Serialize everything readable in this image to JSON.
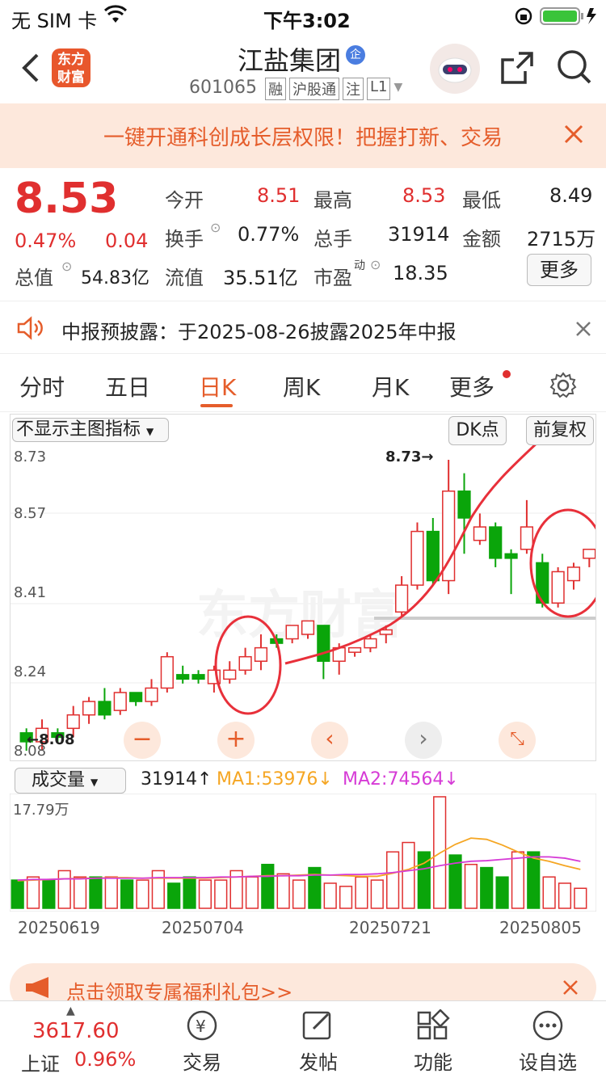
{
  "status": {
    "carrier": "无 SIM 卡",
    "time": "下午3:02"
  },
  "nav": {
    "title": "江盐集团",
    "code": "601065",
    "tags": [
      "融",
      "沪股通",
      "注",
      "L1"
    ]
  },
  "banner": {
    "text": "一键开通科创成长层权限！把握打新、交易"
  },
  "quote": {
    "price": "8.53",
    "pct": "0.47%",
    "change": "0.04",
    "open_label": "今开",
    "open": "8.51",
    "high_label": "最高",
    "high": "8.53",
    "low_label": "最低",
    "low": "8.49",
    "turnover_label": "换手",
    "turnover": "0.77%",
    "vol_label": "总手",
    "vol": "31914",
    "amount_label": "金额",
    "amount": "2715万",
    "mcap_label": "总值",
    "mcap": "54.83亿",
    "float_label": "流值",
    "float": "35.51亿",
    "pe_label": "市盈",
    "pe_sup": "动",
    "pe": "18.35",
    "more": "更多"
  },
  "notice": {
    "text": "中报预披露：于2025-08-26披露2025年中报"
  },
  "tabs": [
    "分时",
    "五日",
    "日K",
    "周K",
    "月K",
    "更多"
  ],
  "chart": {
    "indicator": "不显示主图指标",
    "dk": "DK点",
    "adjust": "前复权",
    "y_labels": [
      "8.73",
      "8.57",
      "8.41",
      "8.24",
      "8.08"
    ],
    "high_mark": "8.73→",
    "low_mark": "←8.08",
    "vol_label": "成交量",
    "vol_value": "31914↑",
    "ma1": "MA1:53976↓",
    "ma2": "MA2:74564↓",
    "vol_max": "17.79万",
    "dates": [
      "20250619",
      "20250704",
      "20250721",
      "20250805"
    ],
    "colors": {
      "up": "#e02f2f",
      "down": "#0aa50a",
      "ma1": "#f5a623",
      "ma2": "#d63bd6"
    }
  },
  "chart_data": {
    "type": "candlestick",
    "ylim": [
      8.08,
      8.73
    ],
    "candles": [
      {
        "o": 8.12,
        "c": 8.1,
        "h": 8.13,
        "l": 8.08
      },
      {
        "o": 8.1,
        "c": 8.13,
        "h": 8.15,
        "l": 8.08
      },
      {
        "o": 8.12,
        "c": 8.11,
        "h": 8.13,
        "l": 8.1
      },
      {
        "o": 8.13,
        "c": 8.16,
        "h": 8.18,
        "l": 8.11
      },
      {
        "o": 8.16,
        "c": 8.19,
        "h": 8.2,
        "l": 8.14
      },
      {
        "o": 8.19,
        "c": 8.16,
        "h": 8.22,
        "l": 8.15
      },
      {
        "o": 8.17,
        "c": 8.21,
        "h": 8.22,
        "l": 8.16
      },
      {
        "o": 8.21,
        "c": 8.19,
        "h": 8.21,
        "l": 8.18
      },
      {
        "o": 8.19,
        "c": 8.22,
        "h": 8.24,
        "l": 8.18
      },
      {
        "o": 8.22,
        "c": 8.29,
        "h": 8.3,
        "l": 8.21
      },
      {
        "o": 8.25,
        "c": 8.24,
        "h": 8.27,
        "l": 8.23
      },
      {
        "o": 8.25,
        "c": 8.24,
        "h": 8.26,
        "l": 8.23
      },
      {
        "o": 8.23,
        "c": 8.26,
        "h": 8.27,
        "l": 8.21
      },
      {
        "o": 8.24,
        "c": 8.26,
        "h": 8.28,
        "l": 8.23
      },
      {
        "o": 8.26,
        "c": 8.29,
        "h": 8.31,
        "l": 8.25
      },
      {
        "o": 8.28,
        "c": 8.31,
        "h": 8.34,
        "l": 8.26
      },
      {
        "o": 8.33,
        "c": 8.32,
        "h": 8.34,
        "l": 8.31
      },
      {
        "o": 8.33,
        "c": 8.36,
        "h": 8.36,
        "l": 8.32
      },
      {
        "o": 8.34,
        "c": 8.37,
        "h": 8.37,
        "l": 8.33
      },
      {
        "o": 8.36,
        "c": 8.28,
        "h": 8.36,
        "l": 8.24
      },
      {
        "o": 8.28,
        "c": 8.31,
        "h": 8.32,
        "l": 8.25
      },
      {
        "o": 8.3,
        "c": 8.31,
        "h": 8.31,
        "l": 8.29
      },
      {
        "o": 8.31,
        "c": 8.33,
        "h": 8.34,
        "l": 8.3
      },
      {
        "o": 8.34,
        "c": 8.35,
        "h": 8.36,
        "l": 8.32
      },
      {
        "o": 8.39,
        "c": 8.45,
        "h": 8.47,
        "l": 8.38
      },
      {
        "o": 8.45,
        "c": 8.57,
        "h": 8.59,
        "l": 8.44
      },
      {
        "o": 8.57,
        "c": 8.46,
        "h": 8.6,
        "l": 8.45
      },
      {
        "o": 8.46,
        "c": 8.66,
        "h": 8.73,
        "l": 8.43
      },
      {
        "o": 8.66,
        "c": 8.6,
        "h": 8.7,
        "l": 8.52
      },
      {
        "o": 8.55,
        "c": 8.58,
        "h": 8.61,
        "l": 8.54
      },
      {
        "o": 8.58,
        "c": 8.51,
        "h": 8.59,
        "l": 8.49
      },
      {
        "o": 8.52,
        "c": 8.51,
        "h": 8.53,
        "l": 8.43
      },
      {
        "o": 8.53,
        "c": 8.58,
        "h": 8.64,
        "l": 8.52
      },
      {
        "o": 8.5,
        "c": 8.41,
        "h": 8.52,
        "l": 8.4
      },
      {
        "o": 8.41,
        "c": 8.48,
        "h": 8.49,
        "l": 8.4
      },
      {
        "o": 8.46,
        "c": 8.49,
        "h": 8.5,
        "l": 8.44
      },
      {
        "o": 8.51,
        "c": 8.53,
        "h": 8.53,
        "l": 8.49
      }
    ],
    "volumes": [
      4.5,
      5.0,
      4.5,
      6.0,
      5.0,
      5.0,
      5.0,
      4.5,
      4.5,
      6.0,
      4.0,
      5.0,
      4.5,
      4.5,
      6.0,
      5.0,
      7.0,
      5.5,
      4.5,
      6.5,
      4.0,
      3.5,
      5.0,
      4.5,
      9.0,
      10.5,
      9.0,
      17.79,
      8.5,
      7.0,
      6.5,
      5.0,
      9.0,
      9.0,
      5.0,
      4.0,
      3.19
    ],
    "ma1": [
      4.4,
      4.5,
      4.6,
      4.7,
      4.8,
      4.8,
      4.9,
      4.9,
      4.8,
      4.8,
      4.8,
      4.8,
      4.8,
      4.9,
      5.0,
      5.1,
      5.2,
      5.2,
      5.3,
      5.4,
      5.3,
      5.2,
      5.1,
      5.1,
      5.6,
      6.2,
      7.2,
      8.8,
      10.2,
      11.2,
      11.0,
      10.1,
      9.0,
      8.0,
      7.5,
      6.8,
      6.2
    ],
    "ma2": [
      4.5,
      4.6,
      4.6,
      4.7,
      4.7,
      4.8,
      4.8,
      4.8,
      4.8,
      4.9,
      4.9,
      4.9,
      4.9,
      5.0,
      5.0,
      5.1,
      5.1,
      5.2,
      5.2,
      5.3,
      5.3,
      5.4,
      5.4,
      5.5,
      5.7,
      6.0,
      6.3,
      6.8,
      7.2,
      7.5,
      7.6,
      7.8,
      8.0,
      8.2,
      8.2,
      8.0,
      7.5
    ]
  },
  "promo": {
    "text": "点击领取专属福利礼包>>"
  },
  "bottom": {
    "index_value": "3617.60",
    "index_name": "上证",
    "index_pct": "0.96%",
    "items": [
      "交易",
      "发帖",
      "功能",
      "设自选"
    ]
  }
}
